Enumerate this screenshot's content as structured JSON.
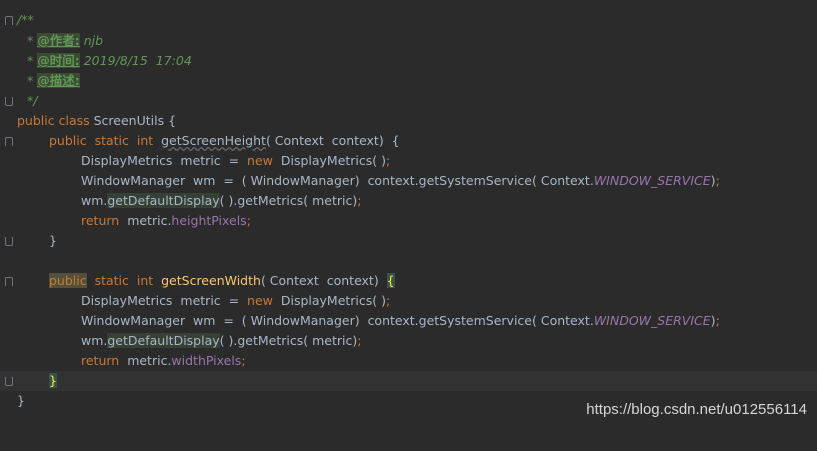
{
  "doc": {
    "open": "/**",
    "author_tag": "@作者:",
    "author_val": " njb",
    "time_tag": "@时间:",
    "time_val": " 2019/8/15  17:04",
    "desc_tag": "@描述:",
    "close": "*/"
  },
  "code": {
    "public": "public",
    "class": "class",
    "class_name": "ScreenUtils",
    "static": "static",
    "int": "int",
    "new": "new",
    "return": "return",
    "m1_name": "getScreenHeight",
    "m2_name": "getScreenWidth",
    "param_type": "Context",
    "param_name": "context",
    "dm_type": "DisplayMetrics",
    "dm_var": "metric",
    "wm_type": "WindowManager",
    "wm_var": "wm",
    "get_service": "context.getSystemService",
    "ctx_class": "Context.",
    "window_service": "WINDOW_SERVICE",
    "wm_prefix": "wm.",
    "get_default_display": "getDefaultDisplay",
    "get_metrics": "().getMetrics",
    "metric_ref": "metric.",
    "height_pixels": "heightPixels",
    "width_pixels": "widthPixels"
  },
  "watermark": "https://blog.csdn.net/u012556114"
}
